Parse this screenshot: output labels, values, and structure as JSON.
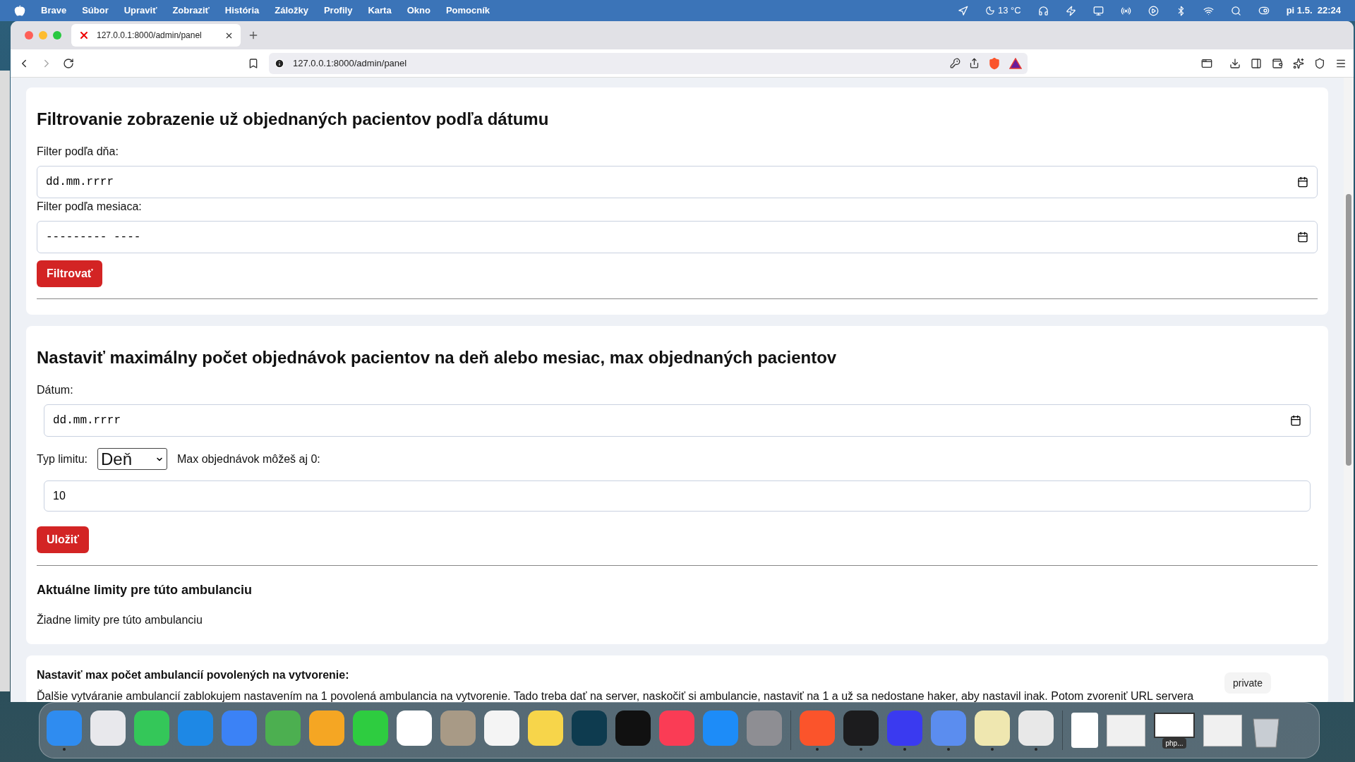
{
  "menu_bar": {
    "app": "Brave",
    "items": [
      "Súbor",
      "Upraviť",
      "Zobraziť",
      "História",
      "Záložky",
      "Profily",
      "Karta",
      "Okno",
      "Pomocník"
    ],
    "weather": "13 °C",
    "clock": "pi 1.5.  22:24"
  },
  "browser": {
    "tabs": [
      {
        "title": "127.0.0.1:8000/admin/panel",
        "selected": true
      }
    ],
    "url": "127.0.0.1:8000/admin/panel"
  },
  "filter_section": {
    "title": "Filtrovanie zobrazenie už objednaných pacientov podľa dátumu",
    "fields": [
      {
        "label": "Filter podľa dňa:",
        "placeholder": "dd.mm.rrrr"
      },
      {
        "label": "Filter podľa mesiaca:",
        "placeholder": "--------- ----"
      }
    ],
    "button": "Filtrovať"
  },
  "limit_section": {
    "title": "Nastaviť maximálny počet objednávok pacientov na deň alebo mesiac, max objednaných pacientov",
    "date_label": "Dátum:",
    "date_placeholder": "dd.mm.rrrr",
    "type_label": "Typ limitu:",
    "type_value": "Deň",
    "max_label": "Max objednávok môžeš aj 0:",
    "max_value": "10",
    "button": "Uložiť",
    "current_title": "Aktuálne limity pre túto ambulanciu",
    "current_text": "Žiadne limity pre túto ambulanciu"
  },
  "ambulance_section": {
    "title": "Nastaviť max počet ambulancií povolených na vytvorenie:",
    "text": "Ďalšie vytváranie ambulancií zablokujem nastavením na 1 povolená ambulancia na vytvorenie. Tado treba dať na server, naskočiť si ambulancie, nastaviť na 1 a už sa nedostane haker, aby nastavil inak. Potom zvoreniť URL servera"
  },
  "dock": {
    "tooltip": "private",
    "apps": [
      {
        "color": "#2f8cf0",
        "running": true
      },
      {
        "color": "#e8e8ec",
        "running": false
      },
      {
        "color": "#34c759",
        "running": false
      },
      {
        "color": "#1e88e5",
        "running": false
      },
      {
        "color": "#3b82f6",
        "running": false
      },
      {
        "color": "#4caf50",
        "running": false
      },
      {
        "color": "#f5a623",
        "running": false
      },
      {
        "color": "#2ecc40",
        "running": false
      },
      {
        "color": "#ffffff",
        "running": false
      },
      {
        "color": "#a89a86",
        "running": false
      },
      {
        "color": "#f4f4f4",
        "running": false
      },
      {
        "color": "#f7d54a",
        "running": false
      },
      {
        "color": "#0e3b4f",
        "running": false
      },
      {
        "color": "#111111",
        "running": false
      },
      {
        "color": "#fa3c55",
        "running": false
      },
      {
        "color": "#1d8cf8",
        "running": false
      },
      {
        "color": "#8e8e93",
        "running": false
      }
    ],
    "apps2": [
      {
        "color": "#fb542b",
        "running": true
      },
      {
        "color": "#1c1c1e",
        "running": true
      },
      {
        "color": "#3a3af0",
        "running": true
      },
      {
        "color": "#5b8def",
        "running": true
      },
      {
        "color": "#efe7b0",
        "running": true
      },
      {
        "color": "#e8e8e8",
        "running": true
      }
    ],
    "thumb_label": "php..."
  }
}
